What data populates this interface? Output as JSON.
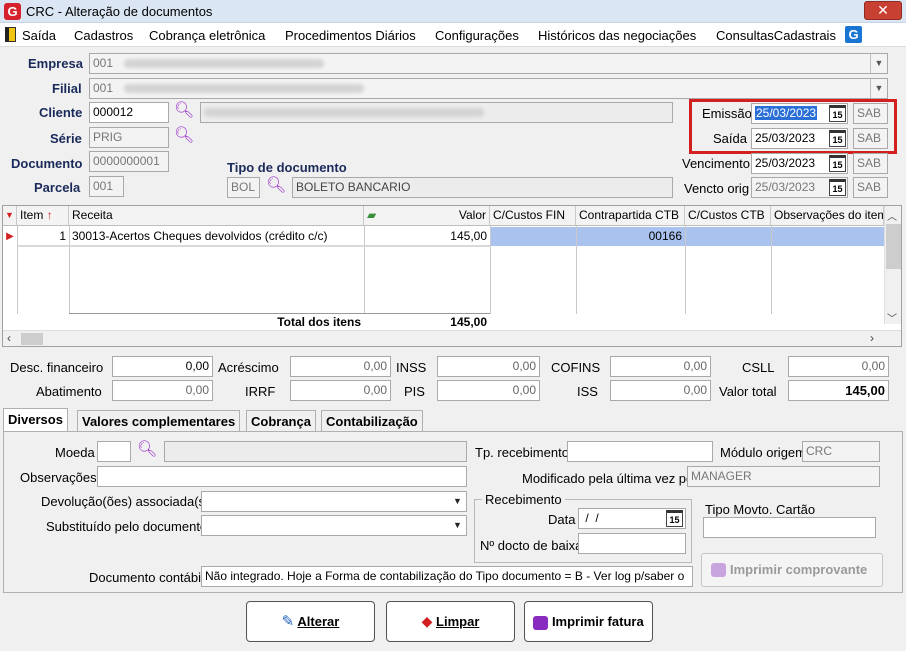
{
  "window": {
    "app_icon": "G",
    "title": "CRC - Alteração de documentos",
    "close": "✕"
  },
  "menu": [
    "Saída",
    "Cadastros",
    "Cobrança eletrônica",
    "Procedimentos Diários",
    "Configurações",
    "Históricos das negociações",
    "ConsultasCadastrais"
  ],
  "header": {
    "empresa_label": "Empresa",
    "empresa_code": "001",
    "filial_label": "Filial",
    "filial_code": "001",
    "cliente_label": "Cliente",
    "cliente_code": "000012",
    "serie_label": "Série",
    "serie_value": "PRIG",
    "documento_label": "Documento",
    "documento_value": "0000000001",
    "parcela_label": "Parcela",
    "parcela_value": "001",
    "tipo_doc_label": "Tipo de documento",
    "tipo_doc_code": "BOL",
    "tipo_doc_desc": "BOLETO BANCARIO"
  },
  "dates": {
    "emissao_label": "Emissão",
    "emissao_value": "25/03/2023",
    "emissao_day": "SAB",
    "saida_label": "Saída",
    "saida_value": "25/03/2023",
    "saida_day": "SAB",
    "vencimento_label": "Vencimento",
    "vencimento_value": "25/03/2023",
    "vencimento_day": "SAB",
    "vencto_orig_label": "Vencto orig",
    "vencto_orig_value": "25/03/2023",
    "vencto_orig_day": "SAB",
    "cal_glyph": "15"
  },
  "grid": {
    "headers": [
      "Item",
      "Receita",
      "Valor",
      "C/Custos FIN",
      "Contrapartida CTB",
      "C/Custos CTB",
      "Observações do item"
    ],
    "row": {
      "item": "1",
      "receita": "30013-Acertos Cheques devolvidos (crédito c/c)",
      "valor": "145,00",
      "contrapartida": "00166"
    },
    "total_label": "Total dos itens",
    "total_value": "145,00"
  },
  "totals": {
    "desc_fin_label": "Desc. financeiro",
    "desc_fin": "0,00",
    "acrescimo_label": "Acréscimo",
    "acrescimo": "0,00",
    "inss_label": "INSS",
    "inss": "0,00",
    "cofins_label": "COFINS",
    "cofins": "0,00",
    "csll_label": "CSLL",
    "csll": "0,00",
    "abatimento_label": "Abatimento",
    "abatimento": "0,00",
    "irrf_label": "IRRF",
    "irrf": "0,00",
    "pis_label": "PIS",
    "pis": "0,00",
    "iss_label": "ISS",
    "iss": "0,00",
    "valor_total_label": "Valor total",
    "valor_total": "145,00"
  },
  "tabs": [
    "Diversos",
    "Valores complementares",
    "Cobrança",
    "Contabilização"
  ],
  "diversos": {
    "moeda_label": "Moeda",
    "obs_label": "Observações",
    "devolucao_label": "Devolução(ões) associada(s)",
    "substituido_label": "Substituído pelo documento",
    "tp_receb_label": "Tp. recebimento",
    "modulo_label": "Módulo origem",
    "modulo_value": "CRC",
    "modificado_label": "Modificado pela última vez por",
    "modificado_value": "MANAGER",
    "recebimento_group": "Recebimento",
    "data_label": "Data",
    "data_value": " /  /",
    "docto_baixa_label": "Nº docto de baixa",
    "tipo_movto_label": "Tipo Movto. Cartão",
    "imprimir_comprovante": "Imprimir comprovante",
    "doc_contabil_label": "Documento contábil",
    "doc_contabil_value": "Não integrado. Hoje a Forma de contabilização do Tipo documento = B - Ver log p/saber o"
  },
  "buttons": {
    "alterar": "Alterar",
    "limpar": "Limpar",
    "imprimir_fatura": "Imprimir fatura"
  },
  "colors": {
    "highlight_box": "#d31f1f",
    "selection": "#2a6fd6",
    "selected_row": "#a9c3ee",
    "label_blue": "#1a2a5a"
  }
}
